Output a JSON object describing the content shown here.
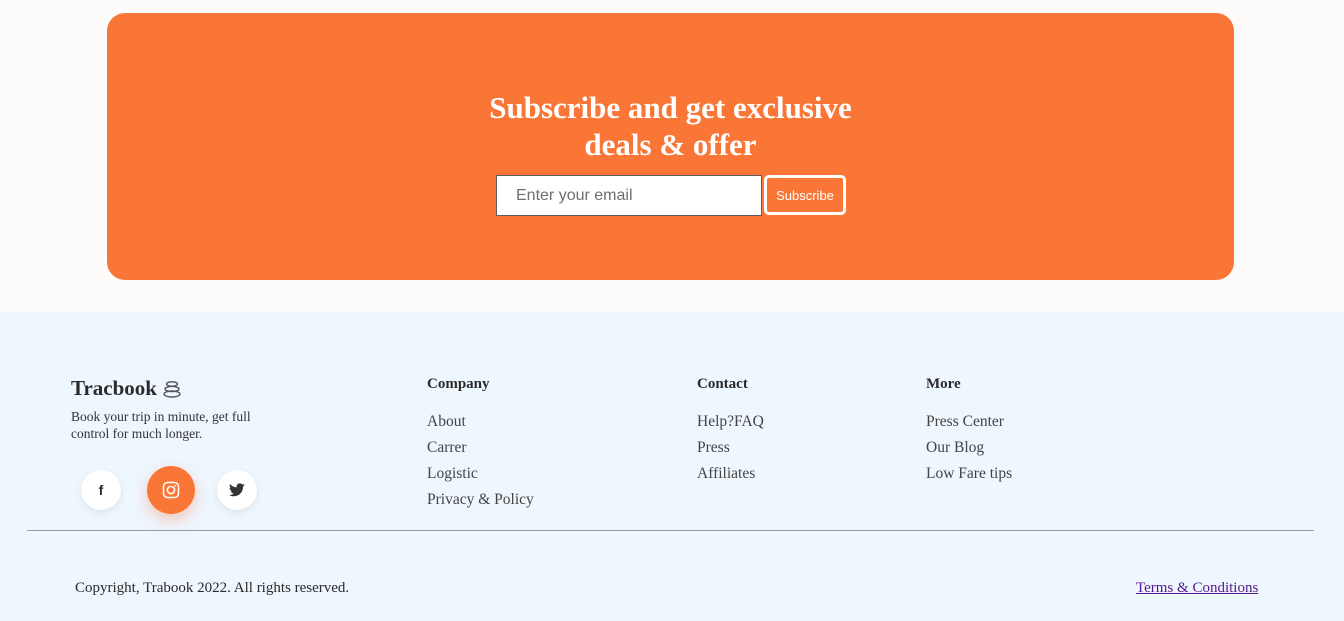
{
  "subscribe": {
    "title_line1": "Subscribe and get exclusive",
    "title_line2": "deals & offer",
    "email_placeholder": "Enter your email",
    "button_label": "Subscribe",
    "accent_color": "#fa7636"
  },
  "footer": {
    "brand": "Tracbook",
    "tagline": "Book your trip in minute, get full control for much longer.",
    "social": [
      {
        "name": "facebook",
        "glyph": "f"
      },
      {
        "name": "instagram",
        "icon": "instagram-icon"
      },
      {
        "name": "twitter",
        "icon": "twitter-icon"
      }
    ],
    "columns": {
      "company": {
        "title": "Company",
        "links": [
          "About",
          "Carrer",
          "Logistic",
          "Privacy & Policy"
        ]
      },
      "contact": {
        "title": "Contact",
        "links": [
          "Help?FAQ",
          "Press",
          "Affiliates"
        ]
      },
      "more": {
        "title": "More",
        "links": [
          "Press Center",
          "Our Blog",
          "Low Fare tips"
        ]
      }
    },
    "copyright": "Copyright, Trabook 2022. All rights reserved.",
    "terms": "Terms & Conditions"
  }
}
